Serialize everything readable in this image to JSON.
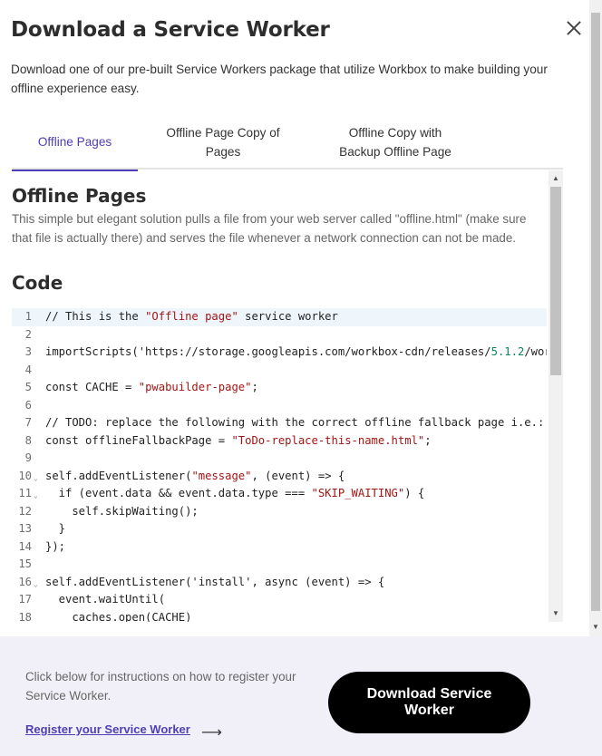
{
  "dialog": {
    "title": "Download a Service Worker",
    "intro": "Download one of our pre-built Service Workers package that utilize Workbox to make building your offline experience easy."
  },
  "tabs": [
    {
      "label": "Offline Pages",
      "active": true
    },
    {
      "label": "Offline Page Copy of Pages",
      "active": false
    },
    {
      "label": "Offline Copy with Backup Offline Page",
      "active": false
    }
  ],
  "panel": {
    "title": "Offline Pages",
    "description": "This simple but elegant solution pulls a file from your web server called \"offline.html\" (make sure that file is actually there) and serves the file whenever a network connection can not be made.",
    "code_title": "Code"
  },
  "code_lines": [
    {
      "n": "1",
      "fold": false,
      "parts": [
        [
          "t",
          "// This is the "
        ],
        [
          "s",
          "\"Offline page\""
        ],
        [
          "t",
          " service worker"
        ]
      ]
    },
    {
      "n": "2",
      "fold": false,
      "parts": []
    },
    {
      "n": "3",
      "fold": false,
      "parts": [
        [
          "t",
          "importScripts('https://storage.googleapis.com/workbox-cdn/releases/"
        ],
        [
          "n",
          "5.1.2"
        ],
        [
          "t",
          "/workbo"
        ]
      ]
    },
    {
      "n": "4",
      "fold": false,
      "parts": []
    },
    {
      "n": "5",
      "fold": false,
      "parts": [
        [
          "t",
          "const CACHE = "
        ],
        [
          "s",
          "\"pwabuilder-page\""
        ],
        [
          "t",
          ";"
        ]
      ]
    },
    {
      "n": "6",
      "fold": false,
      "parts": []
    },
    {
      "n": "7",
      "fold": false,
      "parts": [
        [
          "t",
          "// TODO: replace the following with the correct offline fallback page i.e.: con"
        ]
      ]
    },
    {
      "n": "8",
      "fold": false,
      "parts": [
        [
          "t",
          "const offlineFallbackPage = "
        ],
        [
          "s",
          "\"ToDo-replace-this-name.html\""
        ],
        [
          "t",
          ";"
        ]
      ]
    },
    {
      "n": "9",
      "fold": false,
      "parts": []
    },
    {
      "n": "10",
      "fold": true,
      "parts": [
        [
          "t",
          "self.addEventListener("
        ],
        [
          "s",
          "\"message\""
        ],
        [
          "t",
          ", (event) => {"
        ]
      ]
    },
    {
      "n": "11",
      "fold": true,
      "parts": [
        [
          "t",
          "  if (event.data && event.data.type === "
        ],
        [
          "s",
          "\"SKIP_WAITING\""
        ],
        [
          "t",
          ") {"
        ]
      ]
    },
    {
      "n": "12",
      "fold": false,
      "parts": [
        [
          "t",
          "    self.skipWaiting();"
        ]
      ]
    },
    {
      "n": "13",
      "fold": false,
      "parts": [
        [
          "t",
          "  }"
        ]
      ]
    },
    {
      "n": "14",
      "fold": false,
      "parts": [
        [
          "t",
          "});"
        ]
      ]
    },
    {
      "n": "15",
      "fold": false,
      "parts": []
    },
    {
      "n": "16",
      "fold": true,
      "parts": [
        [
          "t",
          "self.addEventListener('install', async (event) => {"
        ]
      ]
    },
    {
      "n": "17",
      "fold": false,
      "parts": [
        [
          "t",
          "  event.waitUntil("
        ]
      ]
    },
    {
      "n": "18",
      "fold": false,
      "parts": [
        [
          "t",
          "    caches.open(CACHE)"
        ]
      ]
    }
  ],
  "footer": {
    "note": "Click below for instructions on how to register your Service Worker.",
    "register_link": "Register your Service Worker",
    "download_button": "Download Service Worker"
  },
  "icons": {
    "close": "close-icon",
    "arrow": "arrow-right-icon",
    "fold": "chevron-down-icon"
  },
  "colors": {
    "accent": "#4f3fb6",
    "footer_bg": "#f1f0f9",
    "button_bg": "#000000",
    "code_string": "#a31515",
    "code_number": "#098658"
  }
}
